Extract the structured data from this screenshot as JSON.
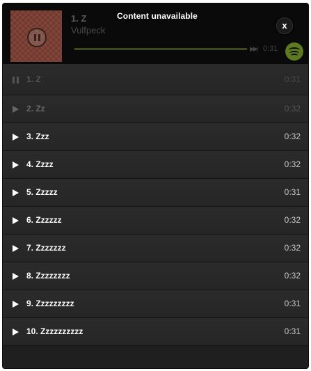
{
  "overlay": {
    "message": "Content unavailable",
    "close_label": "x"
  },
  "now_playing": {
    "title": "1. Z",
    "artist": "Vulfpeck",
    "time": "0:31",
    "progress_fraction": 1.0
  },
  "tracks": [
    {
      "label": "1. Z",
      "duration": "0:31",
      "state": "playing"
    },
    {
      "label": "2. Zz",
      "duration": "0:32",
      "state": "unavailable"
    },
    {
      "label": "3. Zzz",
      "duration": "0:32",
      "state": "available"
    },
    {
      "label": "4. Zzzz",
      "duration": "0:32",
      "state": "available"
    },
    {
      "label": "5. Zzzzz",
      "duration": "0:31",
      "state": "available"
    },
    {
      "label": "6. Zzzzzz",
      "duration": "0:32",
      "state": "available"
    },
    {
      "label": "7. Zzzzzzz",
      "duration": "0:32",
      "state": "available"
    },
    {
      "label": "8. Zzzzzzzz",
      "duration": "0:32",
      "state": "available"
    },
    {
      "label": "9. Zzzzzzzzz",
      "duration": "0:31",
      "state": "available"
    },
    {
      "label": "10. Zzzzzzzzzz",
      "duration": "0:31",
      "state": "available"
    }
  ],
  "icons": {
    "cover_control": "pause-icon",
    "next": "skip-next-icon",
    "brand": "spotify-icon",
    "row_playing": "pause-icon",
    "row_default": "play-icon"
  },
  "colors": {
    "brand_green": "#5d7a1f",
    "panel_bg": "#1f1f1f",
    "header_bg": "#0a0a0a"
  }
}
